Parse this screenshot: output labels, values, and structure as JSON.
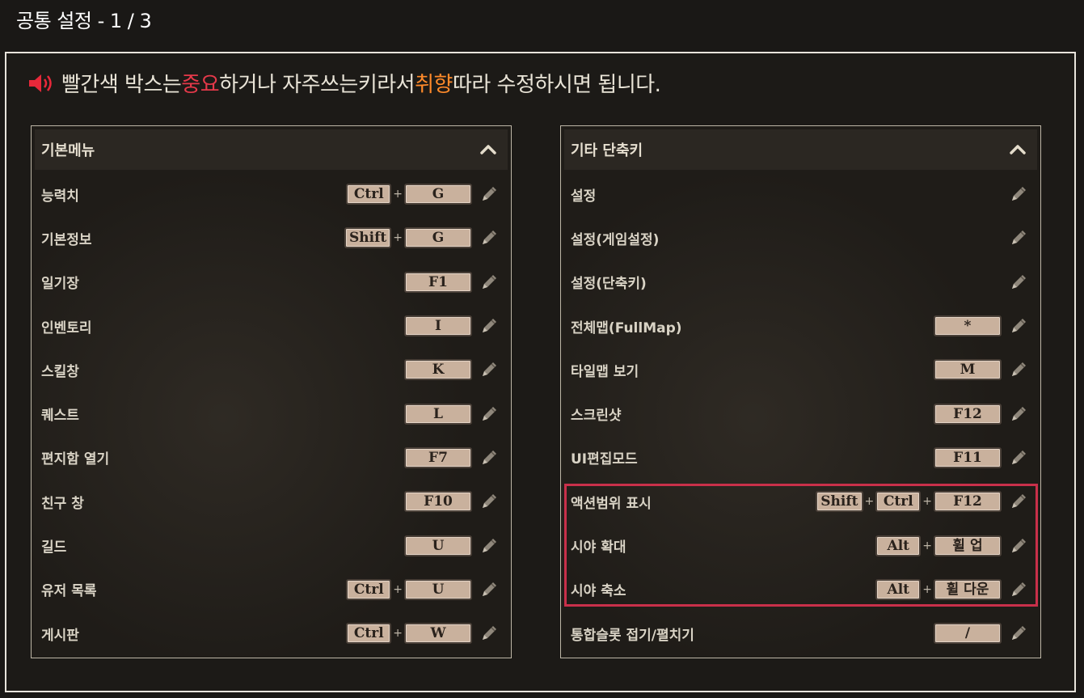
{
  "page_title": "공통 설정 - 1 / 3",
  "notice": {
    "part1": "빨간색 박스는 ",
    "important": "중요",
    "part2": "하거나 자주쓰는키라서 ",
    "preference": "취향",
    "part3": " 따라 수정하시면 됩니다.",
    "important_color": "#e6394a",
    "preference_color": "#ff8a2a"
  },
  "left_panel": {
    "title": "기본메뉴",
    "rows": [
      {
        "label": "능력치",
        "keys": [
          "Ctrl",
          "G"
        ]
      },
      {
        "label": "기본정보",
        "keys": [
          "Shift",
          "G"
        ]
      },
      {
        "label": "일기장",
        "keys": [
          "F1"
        ]
      },
      {
        "label": "인벤토리",
        "keys": [
          "I"
        ]
      },
      {
        "label": "스킬창",
        "keys": [
          "K"
        ]
      },
      {
        "label": "퀘스트",
        "keys": [
          "L"
        ]
      },
      {
        "label": "편지함 열기",
        "keys": [
          "F7"
        ]
      },
      {
        "label": "친구 창",
        "keys": [
          "F10"
        ]
      },
      {
        "label": "길드",
        "keys": [
          "U"
        ]
      },
      {
        "label": "유저 목록",
        "keys": [
          "Ctrl",
          "U"
        ]
      },
      {
        "label": "게시판",
        "keys": [
          "Ctrl",
          "W"
        ]
      }
    ]
  },
  "right_panel": {
    "title": "기타 단축키",
    "rows": [
      {
        "label": "설정",
        "keys": []
      },
      {
        "label": "설정(게임설정)",
        "keys": []
      },
      {
        "label": "설정(단축키)",
        "keys": []
      },
      {
        "label": "전체맵(FullMap)",
        "keys": [
          "*"
        ]
      },
      {
        "label": "타일맵 보기",
        "keys": [
          "M"
        ]
      },
      {
        "label": "스크린샷",
        "keys": [
          "F12"
        ]
      },
      {
        "label": "UI편집모드",
        "keys": [
          "F11"
        ]
      },
      {
        "label": "액션범위 표시",
        "keys": [
          "Shift",
          "Ctrl",
          "F12"
        ]
      },
      {
        "label": "시야 확대",
        "keys": [
          "Alt",
          "휠 업"
        ]
      },
      {
        "label": "시야 축소",
        "keys": [
          "Alt",
          "휠 다운"
        ]
      },
      {
        "label": "통합슬롯 접기/펼치기",
        "keys": [
          "/"
        ]
      }
    ]
  },
  "plus_sign": "+",
  "icons": {
    "speaker": "speaker-icon",
    "edit": "pencil-icon",
    "collapse": "chevron-up-icon"
  },
  "colors": {
    "highlight_box": "#c9304a",
    "key_fill": "#c9b19d"
  }
}
